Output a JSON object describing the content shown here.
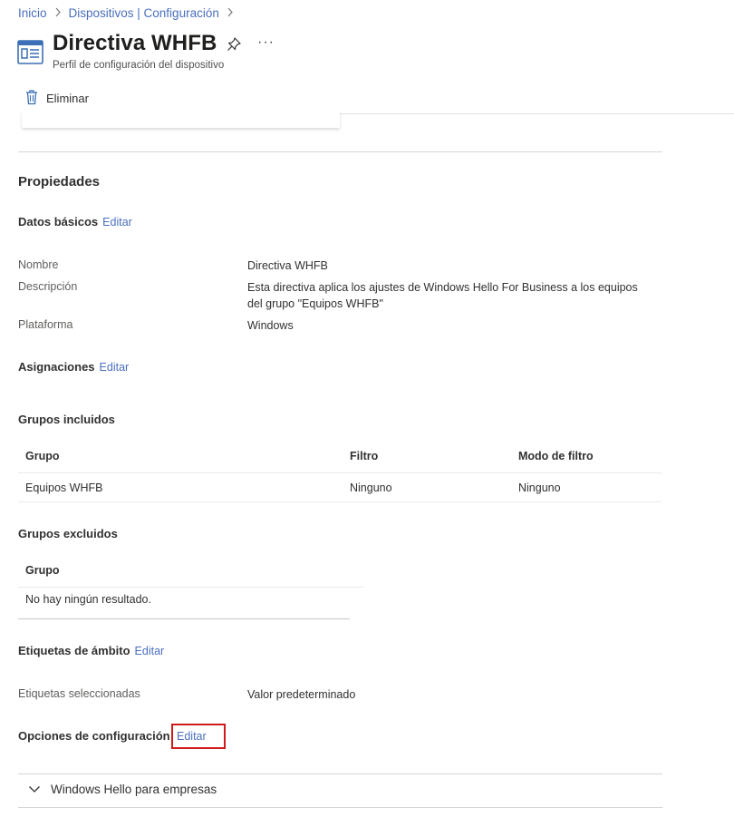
{
  "breadcrumb": {
    "items": [
      "Inicio",
      "Dispositivos | Configuración"
    ]
  },
  "header": {
    "title": "Directiva WHFB",
    "subtitle": "Perfil de configuración del dispositivo",
    "more_label": "···"
  },
  "toolbar": {
    "delete_label": "Eliminar"
  },
  "properties": {
    "title": "Propiedades",
    "basics": {
      "heading": "Datos básicos",
      "edit_label": "Editar",
      "fields": [
        {
          "label": "Nombre",
          "value": "Directiva WHFB"
        },
        {
          "label": "Descripción",
          "value": "Esta directiva aplica los ajustes de Windows Hello For Business a los equipos del grupo \"Equipos WHFB\""
        },
        {
          "label": "Plataforma",
          "value": "Windows"
        }
      ]
    },
    "assignments": {
      "heading": "Asignaciones",
      "edit_label": "Editar",
      "included": {
        "heading": "Grupos incluidos",
        "columns": [
          "Grupo",
          "Filtro",
          "Modo de filtro"
        ],
        "rows": [
          [
            "Equipos WHFB",
            "Ninguno",
            "Ninguno"
          ]
        ]
      },
      "excluded": {
        "heading": "Grupos excluidos",
        "columns": [
          "Grupo"
        ],
        "empty_text": "No hay ningún resultado."
      }
    },
    "scope_tags": {
      "heading": "Etiquetas de ámbito",
      "edit_label": "Editar",
      "label": "Etiquetas seleccionadas",
      "value": "Valor predeterminado"
    },
    "config_options": {
      "heading": "Opciones de configuración",
      "edit_label": "Editar",
      "accordion_label": "Windows Hello para empresas"
    }
  },
  "colors": {
    "link": "#4a6fbf",
    "highlight": "#d11b1b",
    "divider": "#d7d5d3"
  }
}
